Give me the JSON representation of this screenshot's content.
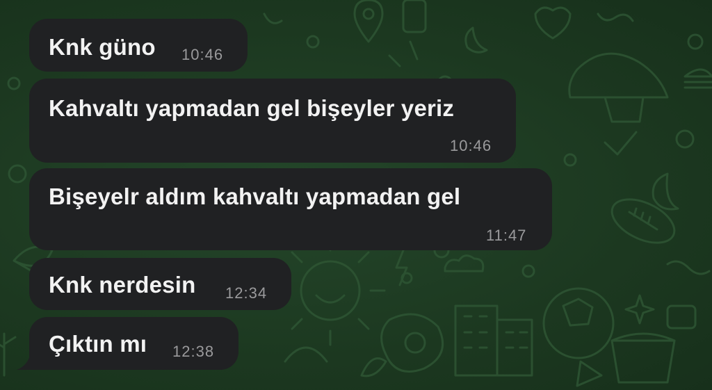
{
  "messages": [
    {
      "text": "Knk güno",
      "time": "10:46",
      "direction": "incoming"
    },
    {
      "text": "Kahvaltı yapmadan gel bişeyler yeriz",
      "time": "10:46",
      "direction": "incoming"
    },
    {
      "text": "Bişeyelr aldım kahvaltı yapmadan gel",
      "time": "11:47",
      "direction": "incoming"
    },
    {
      "text": "Knk nerdesin",
      "time": "12:34",
      "direction": "incoming"
    },
    {
      "text": "Çıktın mı",
      "time": "12:38",
      "direction": "incoming"
    }
  ],
  "colors": {
    "wallpaper": "#1d3a22",
    "doodle": "#2e5433",
    "bubble": "#202123",
    "text": "#f2f2f2",
    "timestamp": "#9a9a9c"
  },
  "icons": [
    "doodle-wallpaper-icon"
  ]
}
